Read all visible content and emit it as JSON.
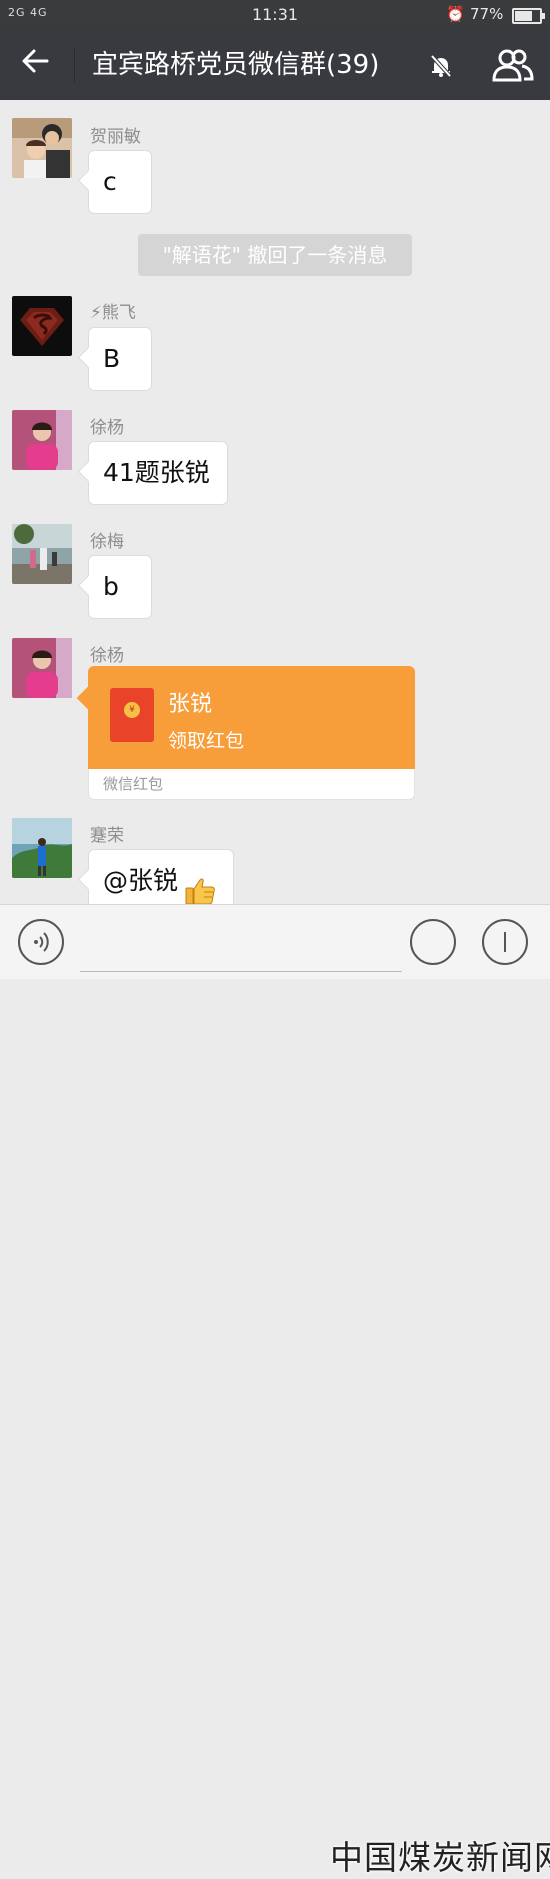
{
  "status_bar": {
    "signal_text": "2G 4G",
    "time": "11:31",
    "battery": "77%",
    "battery_level": 0.77
  },
  "header": {
    "back_icon": "back-arrow-icon",
    "title": "宜宾路桥党员微信群(39)",
    "mute_icon": "bell-muted-icon",
    "members_icon": "group-members-icon"
  },
  "messages": [
    {
      "sender": "贺丽敏",
      "text": "c"
    },
    {
      "system": "\"解语花\" 撤回了一条消息"
    },
    {
      "sender": "⚡熊飞",
      "text": "B"
    },
    {
      "sender": "徐杨",
      "text": "41题张锐"
    },
    {
      "sender": "徐梅",
      "text": "b"
    },
    {
      "sender": "徐杨",
      "red_packet": {
        "title": "张锐",
        "subtitle": "领取红包",
        "footer": "微信红包"
      }
    },
    {
      "sender": "蹇荣",
      "text": "@张锐"
    }
  ],
  "input_bar": {
    "voice_icon": "voice-icon",
    "emoji_icon": "emoji-icon",
    "plus_icon": "plus-icon"
  },
  "watermark": "中国煤炭新闻网",
  "colors": {
    "title_bar": "#393a3f",
    "status_bar": "#3a3b3d",
    "background": "#ebebeb",
    "red_packet": "#f79d3a"
  }
}
